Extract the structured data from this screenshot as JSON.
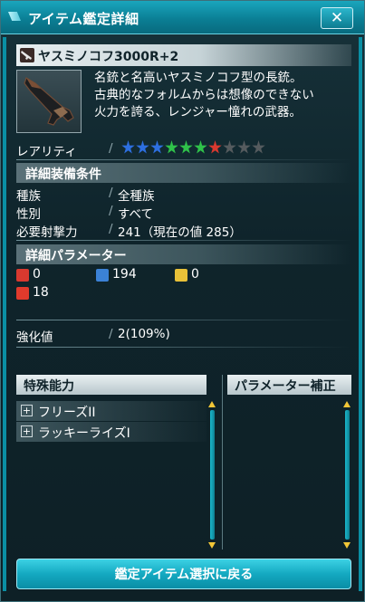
{
  "window": {
    "title": "アイテム鑑定詳細",
    "close_label": "✕"
  },
  "item": {
    "name": "ヤスミノコフ3000R+2",
    "icon": "rifle-icon",
    "description": [
      "名銃と名高いヤスミノコフ型の長銃。",
      "古典的なフォルムからは想像のできない",
      "火力を誇る、レンジャー憧れの武器。"
    ]
  },
  "rarity": {
    "label": "レアリティ",
    "stars": [
      {
        "color": "#2d6fe0"
      },
      {
        "color": "#2d6fe0"
      },
      {
        "color": "#2d6fe0"
      },
      {
        "color": "#2fc24a"
      },
      {
        "color": "#2fc24a"
      },
      {
        "color": "#2fc24a"
      },
      {
        "color": "#d8392f"
      },
      {
        "color": "#555b5e"
      },
      {
        "color": "#555b5e"
      },
      {
        "color": "#555b5e"
      }
    ]
  },
  "equip_conditions": {
    "header": "詳細装備条件",
    "rows": [
      {
        "label": "種族",
        "value": "全種族"
      },
      {
        "label": "性別",
        "value": "すべて"
      },
      {
        "label": "必要射撃力",
        "value": "241（現在の値 285）"
      }
    ]
  },
  "parameters": {
    "header": "詳細パラメーター",
    "items": [
      {
        "icon": "melee-attack-icon",
        "value": "0",
        "color": "#d8392f"
      },
      {
        "icon": "ranged-attack-icon",
        "value": "194",
        "color": "#3b82d6"
      },
      {
        "icon": "technique-attack-icon",
        "value": "0",
        "color": "#e8c138"
      },
      {
        "icon": "element-fire-icon",
        "value": "18",
        "color": "#e03a2c"
      }
    ]
  },
  "grind": {
    "label": "強化値",
    "value": "2(109%)"
  },
  "special_abilities": {
    "header": "特殊能力",
    "items": [
      {
        "label": "フリーズII"
      },
      {
        "label": "ラッキーライズI"
      }
    ]
  },
  "parameter_bonus": {
    "header": "パラメーター補正"
  },
  "back_button": {
    "label": "鑑定アイテム選択に戻る"
  },
  "common": {
    "slash": "/"
  }
}
